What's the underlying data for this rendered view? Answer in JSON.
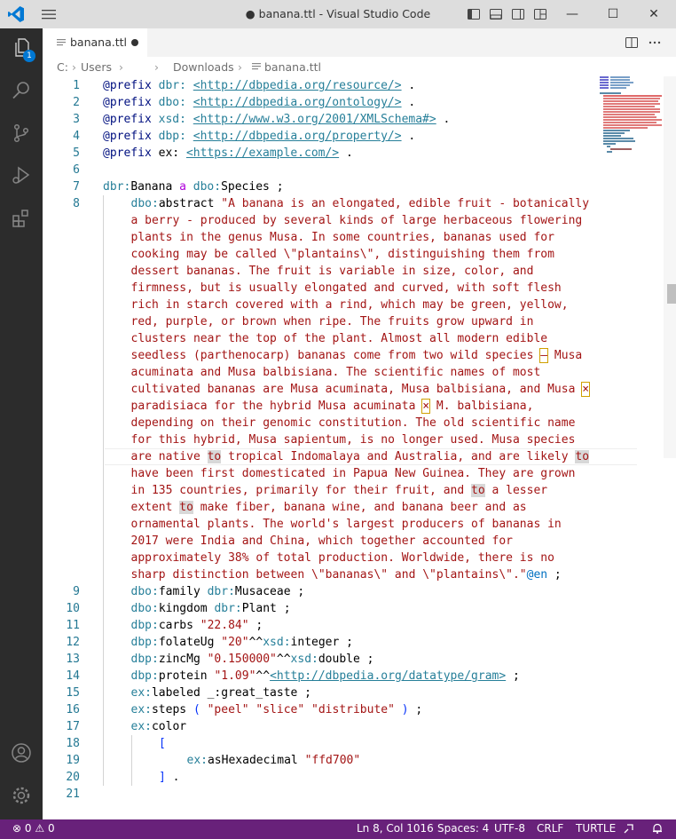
{
  "window": {
    "title": "● banana.ttl - Visual Studio Code",
    "controls": {
      "minimize": "—",
      "maximize": "☐",
      "close": "✕"
    }
  },
  "activity_bar": {
    "items": [
      {
        "name": "explorer",
        "icon": "files-icon",
        "badge": "1"
      },
      {
        "name": "search",
        "icon": "search-icon"
      },
      {
        "name": "source-control",
        "icon": "source-control-icon"
      },
      {
        "name": "run-debug",
        "icon": "run-debug-icon"
      },
      {
        "name": "extensions",
        "icon": "extensions-icon"
      }
    ],
    "bottom_items": [
      {
        "name": "accounts",
        "icon": "account-icon"
      },
      {
        "name": "manage",
        "icon": "gear-icon"
      }
    ]
  },
  "tab": {
    "label": "banana.ttl",
    "dirty": true
  },
  "breadcrumb": [
    "C:",
    "Users",
    "Downloads",
    "banana.ttl"
  ],
  "editor": {
    "lines": [
      {
        "num": "1",
        "parts": [
          [
            "pfx",
            "@prefix "
          ],
          [
            "ns",
            "dbr: "
          ],
          [
            "",
            ""
          ],
          [
            "url",
            "<http://dbpedia.org/resource/>"
          ],
          [
            "",
            " ."
          ]
        ]
      },
      {
        "num": "2",
        "parts": [
          [
            "pfx",
            "@prefix "
          ],
          [
            "ns",
            "dbo: "
          ],
          [
            "url",
            "<http://dbpedia.org/ontology/>"
          ],
          [
            "",
            " ."
          ]
        ]
      },
      {
        "num": "3",
        "parts": [
          [
            "pfx",
            "@prefix "
          ],
          [
            "ns",
            "xsd: "
          ],
          [
            "url",
            "<http://www.w3.org/2001/XMLSchema#>"
          ],
          [
            "",
            " ."
          ]
        ]
      },
      {
        "num": "4",
        "parts": [
          [
            "pfx",
            "@prefix "
          ],
          [
            "ns",
            "dbp: "
          ],
          [
            "url",
            "<http://dbpedia.org/property/>"
          ],
          [
            "",
            " ."
          ]
        ]
      },
      {
        "num": "5",
        "parts": [
          [
            "pfx",
            "@prefix "
          ],
          [
            "",
            "ex: "
          ],
          [
            "url",
            "<https://example.com/>"
          ],
          [
            "",
            " ."
          ]
        ]
      },
      {
        "num": "6",
        "parts": []
      },
      {
        "num": "7",
        "parts": [
          [
            "ns",
            "dbr:"
          ],
          [
            "",
            "Banana "
          ],
          [
            "kw",
            "a "
          ],
          [
            "ns",
            "dbo:"
          ],
          [
            "",
            "Species ;"
          ]
        ]
      },
      {
        "num": "8",
        "indent": 1,
        "parts": [
          [
            "ns",
            "dbo:"
          ],
          [
            "",
            "abstract "
          ],
          [
            "str",
            "\"A banana is an elongated, edible fruit - botanically"
          ]
        ]
      },
      {
        "num": "",
        "indent": 1,
        "parts": [
          [
            "str",
            "a berry - produced by several kinds of large herbaceous flowering"
          ]
        ]
      },
      {
        "num": "",
        "indent": 1,
        "parts": [
          [
            "str",
            "plants in the genus Musa. In some countries, bananas used for"
          ]
        ]
      },
      {
        "num": "",
        "indent": 1,
        "parts": [
          [
            "str",
            "cooking may be called \\\"plantains\\\", distinguishing them from"
          ]
        ]
      },
      {
        "num": "",
        "indent": 1,
        "parts": [
          [
            "str",
            "dessert bananas. The fruit is variable in size, color, and"
          ]
        ]
      },
      {
        "num": "",
        "indent": 1,
        "parts": [
          [
            "str",
            "firmness, but is usually elongated and curved, with soft flesh"
          ]
        ]
      },
      {
        "num": "",
        "indent": 1,
        "parts": [
          [
            "str",
            "rich in starch covered with a rind, which may be green, yellow,"
          ]
        ]
      },
      {
        "num": "",
        "indent": 1,
        "parts": [
          [
            "str",
            "red, purple, or brown when ripe. The fruits grow upward in"
          ]
        ]
      },
      {
        "num": "",
        "indent": 1,
        "parts": [
          [
            "str",
            "clusters near the top of the plant. Almost all modern edible"
          ]
        ]
      },
      {
        "num": "",
        "indent": 1,
        "parts": [
          [
            "str",
            "seedless (parthenocarp) bananas come from two wild species "
          ],
          [
            "warn str",
            "–"
          ],
          [
            "str",
            " Musa"
          ]
        ]
      },
      {
        "num": "",
        "indent": 1,
        "parts": [
          [
            "str",
            "acuminata and Musa balbisiana. The scientific names of most"
          ]
        ]
      },
      {
        "num": "",
        "indent": 1,
        "parts": [
          [
            "str",
            "cultivated bananas are Musa acuminata, Musa balbisiana, and Musa "
          ],
          [
            "warn str",
            "×"
          ]
        ]
      },
      {
        "num": "",
        "indent": 1,
        "parts": [
          [
            "str",
            "paradisiaca for the hybrid Musa acuminata "
          ],
          [
            "warn str",
            "×"
          ],
          [
            "str",
            " M. balbisiana,"
          ]
        ]
      },
      {
        "num": "",
        "indent": 1,
        "parts": [
          [
            "str",
            "depending on their genomic constitution. The old scientific name"
          ]
        ]
      },
      {
        "num": "",
        "indent": 1,
        "parts": [
          [
            "str",
            "for this hybrid, Musa sapientum, is no longer used. Musa species"
          ]
        ]
      },
      {
        "num": "",
        "indent": 1,
        "current": true,
        "parts": [
          [
            "str",
            "are native "
          ],
          [
            "hl str",
            "to"
          ],
          [
            "str",
            " tropical Indomalaya and Australia, and are likely "
          ],
          [
            "hl str",
            "to"
          ]
        ]
      },
      {
        "num": "",
        "indent": 1,
        "parts": [
          [
            "str",
            "have been first domesticated in Papua New Guinea. They are grown"
          ]
        ]
      },
      {
        "num": "",
        "indent": 1,
        "parts": [
          [
            "str",
            "in 135 countries, primarily for their fruit, and "
          ],
          [
            "hl str",
            "to"
          ],
          [
            "str",
            " a lesser"
          ]
        ]
      },
      {
        "num": "",
        "indent": 1,
        "parts": [
          [
            "str",
            "extent "
          ],
          [
            "hl str",
            "to"
          ],
          [
            "str",
            " make fiber, banana wine, and banana beer and as"
          ]
        ]
      },
      {
        "num": "",
        "indent": 1,
        "parts": [
          [
            "str",
            "ornamental plants. The world's largest producers of bananas in"
          ]
        ]
      },
      {
        "num": "",
        "indent": 1,
        "parts": [
          [
            "str",
            "2017 were India and China, which together accounted for"
          ]
        ]
      },
      {
        "num": "",
        "indent": 1,
        "parts": [
          [
            "str",
            "approximately 38% of total production. Worldwide, there is no"
          ]
        ]
      },
      {
        "num": "",
        "indent": 1,
        "parts": [
          [
            "str",
            "sharp distinction between \\\"bananas\\\" and \\\"plantains\\\".\""
          ],
          [
            "tag",
            "@en"
          ],
          [
            "",
            " ;"
          ]
        ]
      },
      {
        "num": "9",
        "indent": 1,
        "parts": [
          [
            "ns",
            "dbo:"
          ],
          [
            "",
            "family "
          ],
          [
            "ns",
            "dbr:"
          ],
          [
            "",
            "Musaceae ;"
          ]
        ]
      },
      {
        "num": "10",
        "indent": 1,
        "parts": [
          [
            "ns",
            "dbo:"
          ],
          [
            "",
            "kingdom "
          ],
          [
            "ns",
            "dbr:"
          ],
          [
            "",
            "Plant ;"
          ]
        ]
      },
      {
        "num": "11",
        "indent": 1,
        "parts": [
          [
            "ns",
            "dbp:"
          ],
          [
            "",
            "carbs "
          ],
          [
            "str",
            "\"22.84\""
          ],
          [
            "",
            " ;"
          ]
        ]
      },
      {
        "num": "12",
        "indent": 1,
        "parts": [
          [
            "ns",
            "dbp:"
          ],
          [
            "",
            "folateUg "
          ],
          [
            "str",
            "\"20\""
          ],
          [
            "",
            "^^"
          ],
          [
            "ns",
            "xsd:"
          ],
          [
            "",
            "integer ;"
          ]
        ]
      },
      {
        "num": "13",
        "indent": 1,
        "parts": [
          [
            "ns",
            "dbp:"
          ],
          [
            "",
            "zincMg "
          ],
          [
            "str",
            "\"0.150000\""
          ],
          [
            "",
            "^^"
          ],
          [
            "ns",
            "xsd:"
          ],
          [
            "",
            "double ;"
          ]
        ]
      },
      {
        "num": "14",
        "indent": 1,
        "parts": [
          [
            "ns",
            "dbp:"
          ],
          [
            "",
            "protein "
          ],
          [
            "str",
            "\"1.09\""
          ],
          [
            "",
            "^^"
          ],
          [
            "url",
            "<http://dbpedia.org/datatype/gram>"
          ],
          [
            "",
            " ;"
          ]
        ]
      },
      {
        "num": "15",
        "indent": 1,
        "parts": [
          [
            "ns",
            "ex:"
          ],
          [
            "",
            "labeled _:great_taste ;"
          ]
        ]
      },
      {
        "num": "16",
        "indent": 1,
        "parts": [
          [
            "ns",
            "ex:"
          ],
          [
            "",
            "steps "
          ],
          [
            "bra",
            "( "
          ],
          [
            "str",
            "\"peel\" \"slice\" \"distribute\""
          ],
          [
            "bra",
            " )"
          ],
          [
            "",
            " ;"
          ]
        ]
      },
      {
        "num": "17",
        "indent": 1,
        "parts": [
          [
            "ns",
            "ex:"
          ],
          [
            "",
            "color"
          ]
        ]
      },
      {
        "num": "18",
        "indent": 2,
        "parts": [
          [
            "bra",
            "["
          ]
        ]
      },
      {
        "num": "19",
        "indent": 3,
        "parts": [
          [
            "ns",
            "ex:"
          ],
          [
            "",
            "asHexadecimal "
          ],
          [
            "str",
            "\"ffd700\""
          ]
        ]
      },
      {
        "num": "20",
        "indent": 2,
        "parts": [
          [
            "bra",
            "]"
          ],
          [
            "",
            " ."
          ]
        ]
      },
      {
        "num": "21",
        "parts": []
      }
    ]
  },
  "status_bar": {
    "errors": "0",
    "warnings": "0",
    "position": "Ln 8, Col 1016",
    "spaces": "Spaces: 4",
    "encoding": "UTF-8",
    "eol": "CRLF",
    "language": "TURTLE"
  },
  "colors": {
    "status_bar": "#68217a",
    "activity_bar": "#2c2c2c",
    "title_bar": "#dddddd",
    "accent": "#0078d4"
  }
}
